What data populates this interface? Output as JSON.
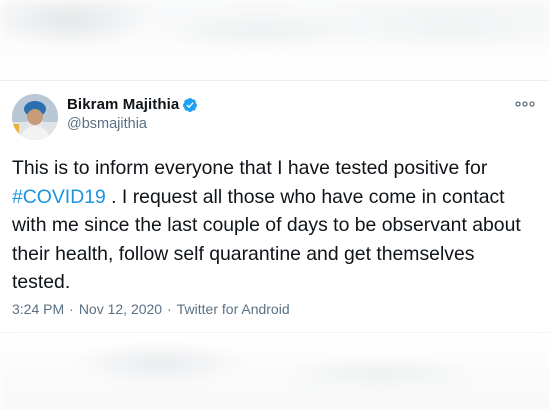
{
  "tweet": {
    "author": {
      "display_name": "Bikram Majithia",
      "handle": "@bsmajithia",
      "verified": true,
      "avatar": "profile-photo"
    },
    "more_icon": "more-horizontal-icon",
    "text_before": "This is to inform everyone that I have tested positive for ",
    "hashtag": "#COVID19",
    "text_after": " . I request all those who have come in contact with me since the last couple of days to be observant about their health, follow self quarantine and get themselves tested.",
    "time": "3:24 PM",
    "date": "Nov 12, 2020",
    "separator": "·",
    "source": "Twitter for Android"
  },
  "colors": {
    "text": "#0f1419",
    "secondary": "#5b7083",
    "link": "#1b95e0",
    "verified": "#1da1f2"
  }
}
